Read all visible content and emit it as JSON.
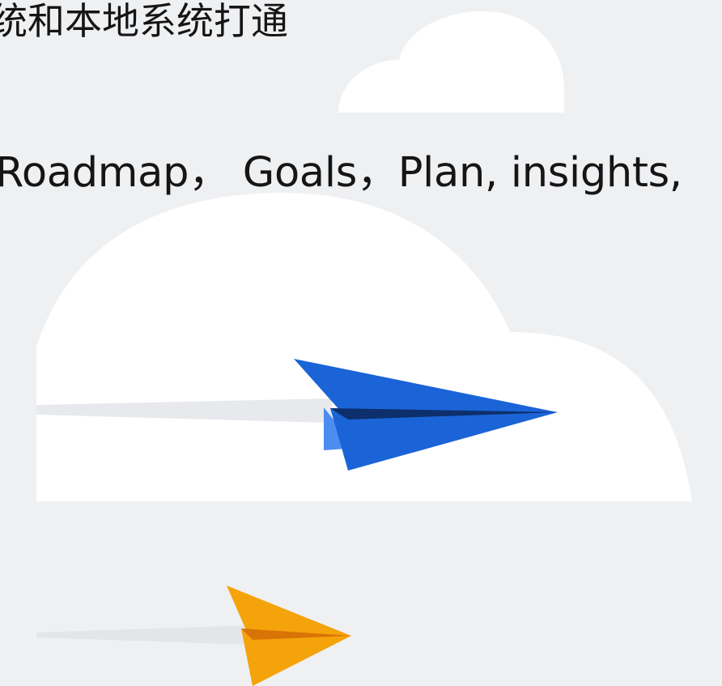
{
  "text": {
    "line1": "统和本地系统打通",
    "line2": "Roadmap， Goals，Plan, insights,"
  },
  "colors": {
    "background": "#eff0f2",
    "cloud": "#ffffff",
    "plane_blue": "#1b64d8",
    "plane_blue_dark": "#0d2f6b",
    "plane_blue_light": "#4d8df0",
    "plane_orange": "#f5a30a",
    "plane_orange_dark": "#d87406",
    "trail": "#e6e7ea"
  },
  "icons": {
    "small_cloud": "cloud-icon",
    "large_cloud": "cloud-icon",
    "blue_plane": "paper-plane-icon",
    "orange_plane": "paper-plane-icon"
  }
}
